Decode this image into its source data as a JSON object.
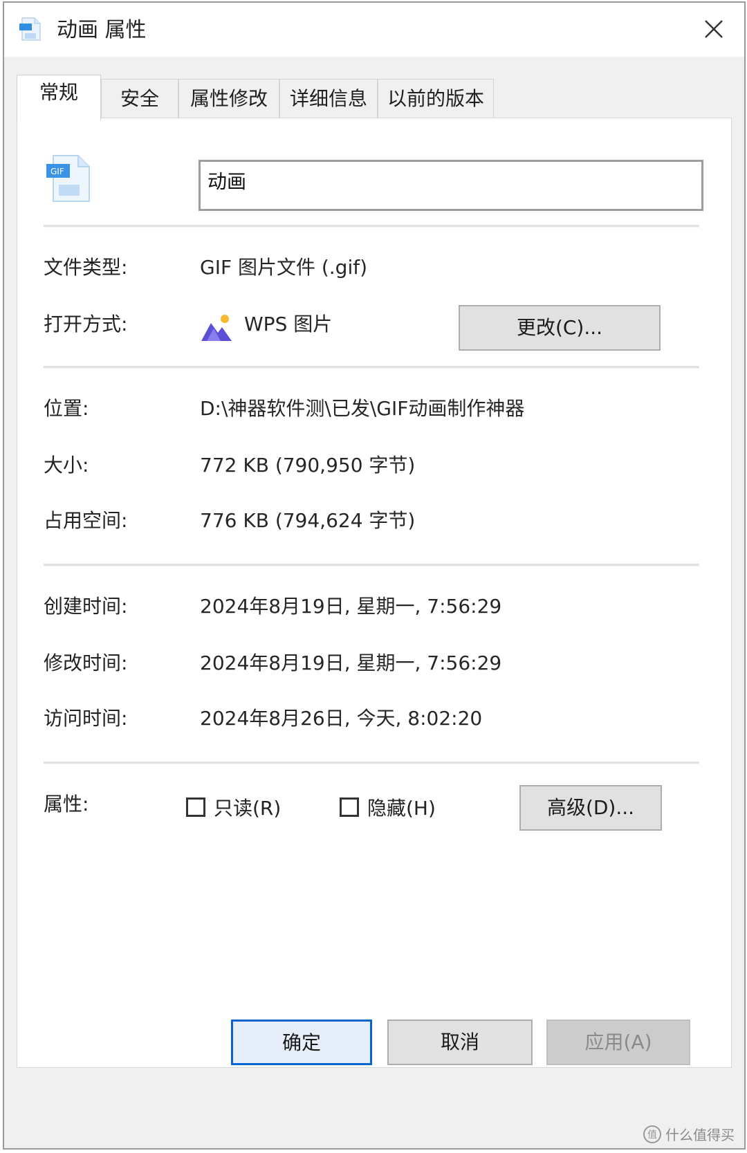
{
  "window": {
    "title": "动画 属性"
  },
  "tabs": [
    {
      "label": "常规",
      "active": true
    },
    {
      "label": "安全",
      "active": false
    },
    {
      "label": "属性修改",
      "active": false
    },
    {
      "label": "详细信息",
      "active": false
    },
    {
      "label": "以前的版本",
      "active": false
    }
  ],
  "general": {
    "file_name": "动画",
    "file_type_label": "文件类型:",
    "file_type_value": "GIF 图片文件 (.gif)",
    "open_with_label": "打开方式:",
    "open_with_value": "WPS 图片",
    "change_button": "更改(C)...",
    "location_label": "位置:",
    "location_value": "D:\\神器软件测\\已发\\GIF动画制作神器",
    "size_label": "大小:",
    "size_value": "772 KB (790,950 字节)",
    "disk_size_label": "占用空间:",
    "disk_size_value": "776 KB (794,624 字节)",
    "created_label": "创建时间:",
    "created_value": "2024年8月19日, 星期一, 7:56:29",
    "modified_label": "修改时间:",
    "modified_value": "2024年8月19日, 星期一, 7:56:29",
    "accessed_label": "访问时间:",
    "accessed_value": "2024年8月26日, 今天, 8:02:20",
    "attributes_label": "属性:",
    "readonly_label": "只读(R)",
    "readonly_checked": false,
    "hidden_label": "隐藏(H)",
    "hidden_checked": false,
    "advanced_button": "高级(D)..."
  },
  "footer": {
    "ok_button": "确定",
    "cancel_button": "取消",
    "apply_button": "应用(A)"
  },
  "watermark": {
    "symbol": "值",
    "text": "什么值得买"
  },
  "colors": {
    "accent": "#0a64d0",
    "button_bg": "#e1e1e1",
    "dialog_bg": "#f0f0f0"
  }
}
